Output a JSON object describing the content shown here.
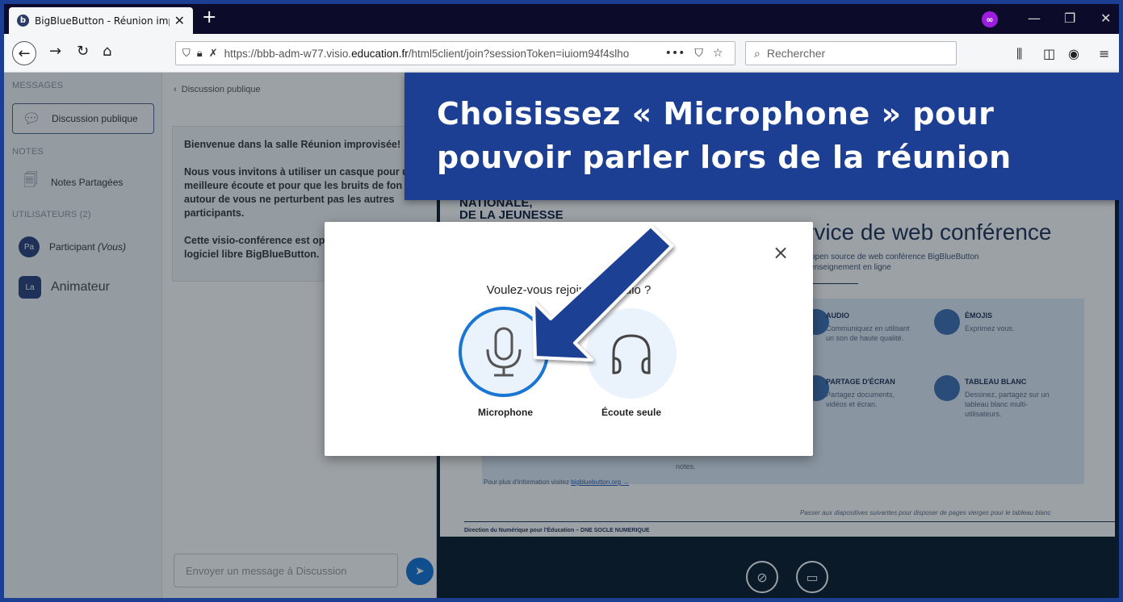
{
  "browser": {
    "tab_title": "BigBlueButton - Réunion improvisée",
    "tab_close": "✕",
    "new_tab": "+",
    "private_icon": "∞",
    "url_prefix": "https://bbb-adm-w77.visio.",
    "url_domain": "education.fr",
    "url_path": "/html5client/join?sessionToken=iuiom94f4slho",
    "url_more": "•••",
    "search_placeholder": "Rechercher"
  },
  "sidebar": {
    "messages_title": "MESSAGES",
    "public_chat": "Discussion publique",
    "notes_title": "NOTES",
    "shared_notes": "Notes Partagées",
    "users_title": "UTILISATEURS (2)",
    "participant_initials": "Pa",
    "participant_name": "Participant",
    "participant_you": "(Vous)",
    "moderator_initials": "La",
    "moderator_name": "Animateur"
  },
  "chat": {
    "back_label": "Discussion publique",
    "welcome_line1": "Bienvenue dans la salle Réunion improvisée!",
    "welcome_line2": "Nous vous invitons à utiliser un casque pour u",
    "welcome_line3": "meilleure écoute et pour que les bruits de fon",
    "welcome_line4": "autour de vous ne perturbent pas les autres",
    "welcome_line5": "participants.",
    "welcome_line6": "Cette visio-conférence est op",
    "welcome_line7": "logiciel libre BigBlueButton.",
    "input_placeholder": "Envoyer un message à Discussion"
  },
  "slide": {
    "brand_line1": "NATIONALE,",
    "brand_line2": "DE LA JEUNESSE",
    "title": "rvice de web conférence",
    "subtitle_line1": "l open source de web conférence BigBlueButton",
    "subtitle_line2": "l'enseignement en ligne",
    "audio_title": "AUDIO",
    "audio_text": "Communiquez en utilisant un son de haute qualité.",
    "emojis_title": "ÉMOJIS",
    "emojis_text": "Exprimez vous.",
    "screen_title": "PARTAGE D'ÉCRAN",
    "screen_text": "Partagez documents, vidéos et écran.",
    "board_title": "TABLEAU BLANC",
    "board_text": "Dessinez, partagez sur un tableau blanc multi-utilisateurs.",
    "notes_text": "notes.",
    "more_info_prefix": "Pour plus d'information visitez",
    "more_info_link": "bigbluebutton.org →",
    "next_slides": "Passer aux diapositives suivantes pour disposer de pages vierges pour le tableau blanc",
    "footer": "Direction du Numérique pour l'Éducation – DNE SOCLE NUMERIQUE"
  },
  "modal": {
    "question": "Voulez-vous rejoindre l'audio ?",
    "microphone_label": "Microphone",
    "listen_only_label": "Écoute seule",
    "close_glyph": "×"
  },
  "callout": {
    "line1": "Choisissez « Microphone » pour",
    "line2": "pouvoir parler lors de la réunion"
  },
  "colors": {
    "callout_bg": "#1c3f94",
    "arrow": "#1c3f94",
    "accent_blue": "#1a76d2",
    "presentation_bg": "#06172a"
  }
}
